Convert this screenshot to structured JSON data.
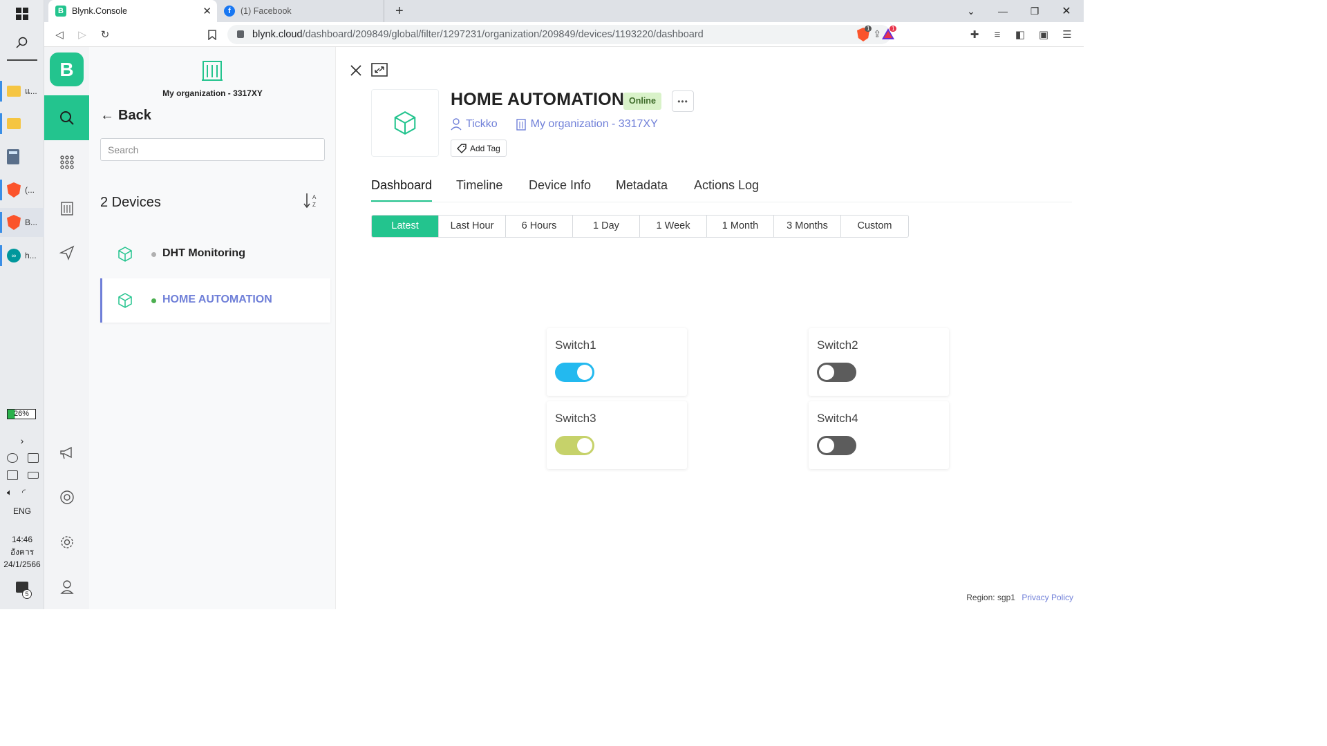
{
  "taskbar": {
    "apps": [
      {
        "label": "แ...",
        "icon": "folder-icon"
      },
      {
        "label": "",
        "icon": "folder-icon"
      },
      {
        "label": "",
        "icon": "calculator-icon"
      },
      {
        "label": "(...",
        "icon": "brave-icon"
      },
      {
        "label": "B...",
        "icon": "brave-icon"
      },
      {
        "label": "h...",
        "icon": "arduino-icon"
      }
    ],
    "battery": "26%",
    "language": "ENG",
    "time": "14:46",
    "day": "อังคาร",
    "date": "24/1/2566",
    "notification_count": "5"
  },
  "browser": {
    "tabs": [
      {
        "title": "Blynk.Console",
        "icon": "blynk-favicon",
        "active": true
      },
      {
        "title": "(1) Facebook",
        "icon": "facebook-favicon",
        "active": false
      }
    ],
    "url_host": "blynk.cloud",
    "url_path": "/dashboard/209849/global/filter/1297231/organization/209849/devices/1193220/dashboard",
    "brave_badge": "1",
    "rewards_badge": "1"
  },
  "sidebar": {
    "logo": "B"
  },
  "devices_panel": {
    "org_name": "My organization - 3317XY",
    "back_label": "Back",
    "search_placeholder": "Search",
    "count_label": "2 Devices",
    "devices": [
      {
        "name": "DHT Monitoring",
        "status": "offline",
        "status_color": "#b0b0b0",
        "selected": false
      },
      {
        "name": "HOME AUTOMATION",
        "status": "online",
        "status_color": "#4caf50",
        "selected": true
      }
    ]
  },
  "device": {
    "name": "HOME AUTOMATION",
    "status": "Online",
    "owner": "Tickko",
    "organization": "My organization - 3317XY",
    "add_tag_label": "Add Tag",
    "tabs": [
      "Dashboard",
      "Timeline",
      "Device Info",
      "Metadata",
      "Actions Log"
    ],
    "active_tab": "Dashboard",
    "time_ranges": [
      "Latest",
      "Last Hour",
      "6 Hours",
      "1 Day",
      "1 Week",
      "1 Month",
      "3 Months",
      "Custom"
    ],
    "active_range": "Latest",
    "widgets": [
      {
        "label": "Switch1",
        "state": "on",
        "color": "#23b9ef"
      },
      {
        "label": "Switch2",
        "state": "off",
        "color": "#5c5c5c"
      },
      {
        "label": "Switch3",
        "state": "on",
        "color": "#c6d26a"
      },
      {
        "label": "Switch4",
        "state": "off",
        "color": "#5c5c5c"
      }
    ]
  },
  "footer": {
    "region": "Region: sgp1",
    "privacy": "Privacy Policy"
  },
  "colors": {
    "brand": "#23c48e",
    "link": "#6f7fd8"
  }
}
